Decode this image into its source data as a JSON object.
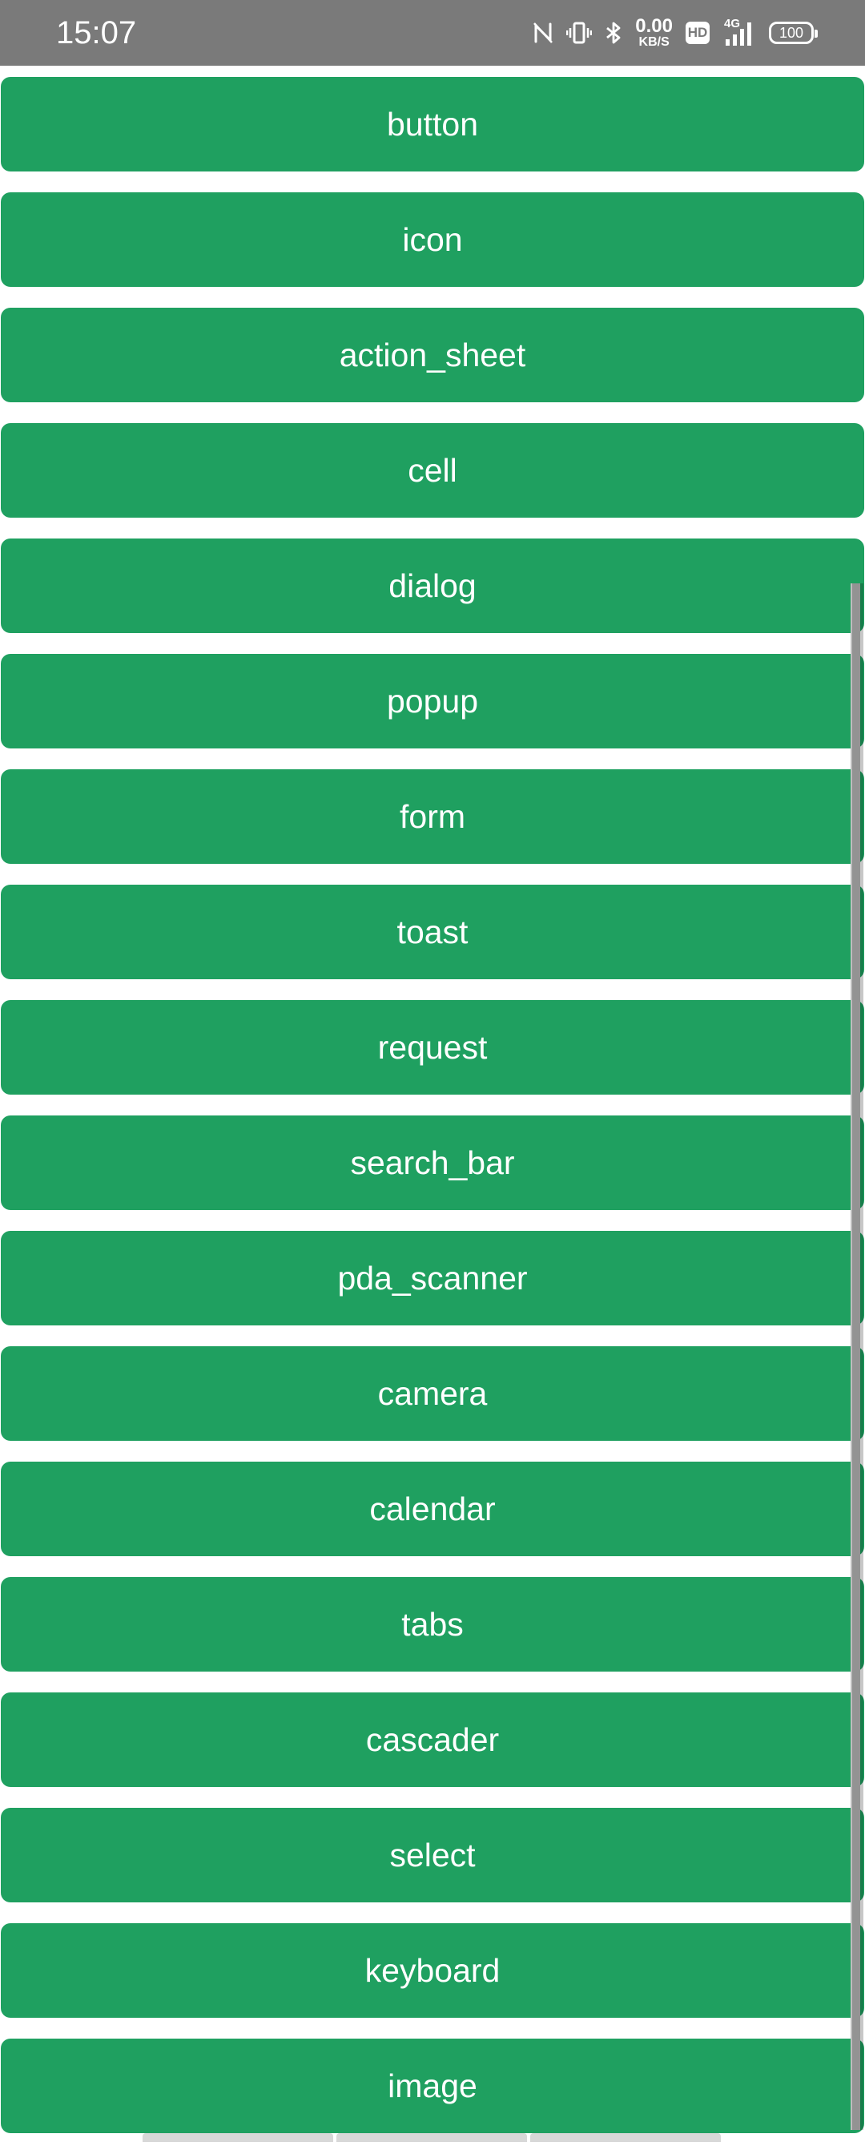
{
  "status_bar": {
    "time": "15:07",
    "net_speed_value": "0.00",
    "net_speed_unit": "KB/S",
    "hd_label": "HD",
    "network_type": "4G",
    "battery_level": "100",
    "icons": [
      "nfc-icon",
      "vibrate-icon",
      "bluetooth-icon",
      "hd-icon",
      "signal-icon",
      "battery-icon"
    ]
  },
  "colors": {
    "button_bg": "#1fa060",
    "status_bar_bg": "#7a7a7a"
  },
  "menu": {
    "items": [
      {
        "label": "button"
      },
      {
        "label": "icon"
      },
      {
        "label": "action_sheet"
      },
      {
        "label": "cell"
      },
      {
        "label": "dialog"
      },
      {
        "label": "popup"
      },
      {
        "label": "form"
      },
      {
        "label": "toast"
      },
      {
        "label": "request"
      },
      {
        "label": "search_bar"
      },
      {
        "label": "pda_scanner"
      },
      {
        "label": "camera"
      },
      {
        "label": "calendar"
      },
      {
        "label": "tabs"
      },
      {
        "label": "cascader"
      },
      {
        "label": "select"
      },
      {
        "label": "keyboard"
      },
      {
        "label": "image"
      }
    ]
  }
}
